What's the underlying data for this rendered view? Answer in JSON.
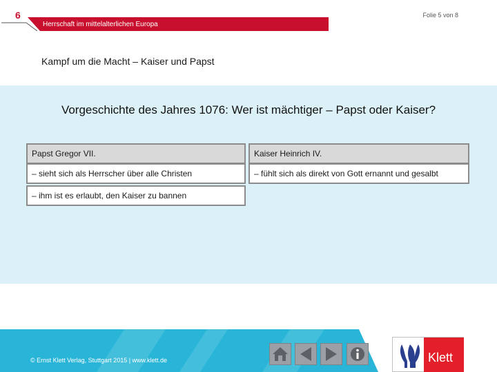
{
  "header": {
    "chapter_number": "6",
    "slide_counter": "Folie 5 von 8",
    "topic": "Herrschaft im mittelalterlichen Europa"
  },
  "slide": {
    "title": "Kampf um die Macht – Kaiser und Papst",
    "question": "Vorgeschichte des Jahres 1076: Wer ist mächtiger – Papst oder Kaiser?"
  },
  "table": {
    "left": {
      "heading": "Papst Gregor VII.",
      "items": [
        "– sieht sich als Herrscher über alle Christen",
        "– ihm ist es erlaubt, den Kaiser zu bannen"
      ]
    },
    "right": {
      "heading": "Kaiser Heinrich IV.",
      "items": [
        "– fühlt sich als direkt von Gott ernannt und gesalbt"
      ]
    }
  },
  "footer": {
    "copyright": "© Ernst Klett Verlag, Stuttgart 2015 | www.klett.de",
    "logo_text": "Klett",
    "nav_icons": [
      "home-icon",
      "back-arrow-icon",
      "forward-arrow-icon",
      "info-icon"
    ],
    "colors": {
      "footer": "#29b5d7",
      "accent": "#c8102e",
      "panel": "#dcf1f7"
    }
  }
}
